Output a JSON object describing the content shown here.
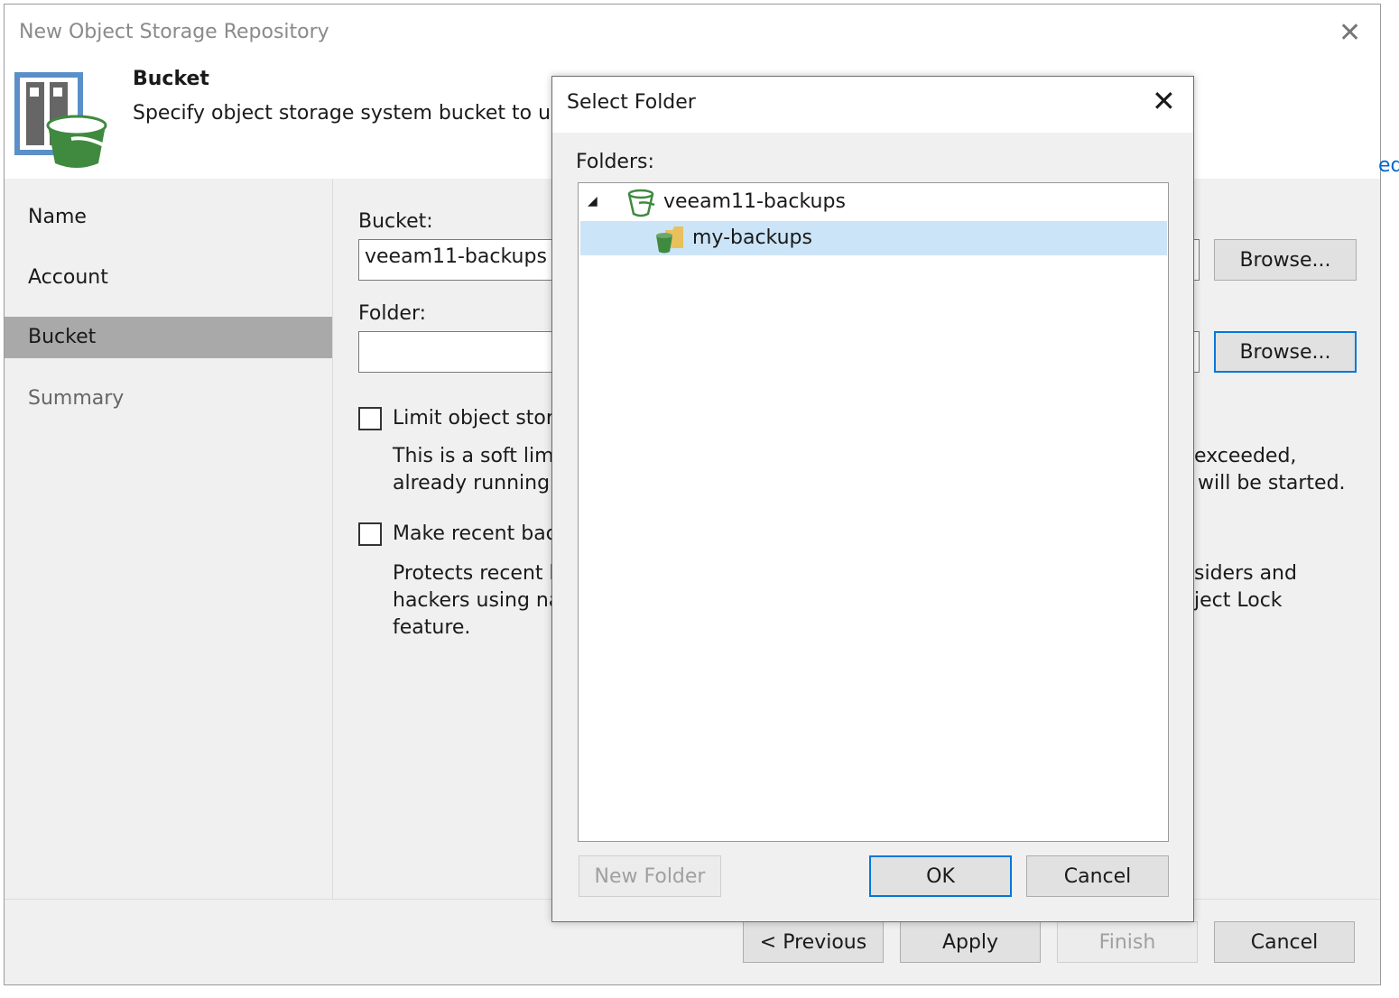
{
  "window": {
    "title": "New Object Storage Repository",
    "close_icon": "close-icon"
  },
  "header": {
    "title": "Bucket",
    "subtitle": "Specify object storage system bucket to use",
    "right_link_fragment": "ed"
  },
  "nav": {
    "items": [
      {
        "label": "Name"
      },
      {
        "label": "Account"
      },
      {
        "label": "Bucket",
        "selected": true
      },
      {
        "label": "Summary"
      }
    ]
  },
  "form": {
    "bucket_label": "Bucket:",
    "bucket_value": "veeam11-backups",
    "folder_label": "Folder:",
    "folder_value": "",
    "browse1": "Browse...",
    "browse2": "Browse...",
    "limit_label": "Limit object stor",
    "limit_desc1": "This is a soft limi",
    "limit_desc2": "already running",
    "limit_desc1_right": "exceeded,",
    "limit_desc2_right": "will be started.",
    "immutable_label": "Make recent bac",
    "imm_desc1": "Protects recent b",
    "imm_desc2": "hackers using na",
    "imm_desc3": "feature.",
    "imm_desc1_right": "siders and",
    "imm_desc2_right": "ject Lock"
  },
  "footer": {
    "previous": "< Previous",
    "apply": "Apply",
    "finish": "Finish",
    "cancel": "Cancel"
  },
  "dialog": {
    "title": "Select Folder",
    "folders_label": "Folders:",
    "tree": [
      {
        "label": "veeam11-backups",
        "icon": "bucket-icon",
        "expanded": true
      },
      {
        "label": "my-backups",
        "icon": "folder-bucket-icon",
        "selected": true
      }
    ],
    "new_folder": "New Folder",
    "ok": "OK",
    "cancel": "Cancel"
  },
  "colors": {
    "selection": "#cce4f7",
    "focus": "#0078d7",
    "nav_selected": "#a9a9a9",
    "bucket_green": "#3f8a3f"
  }
}
